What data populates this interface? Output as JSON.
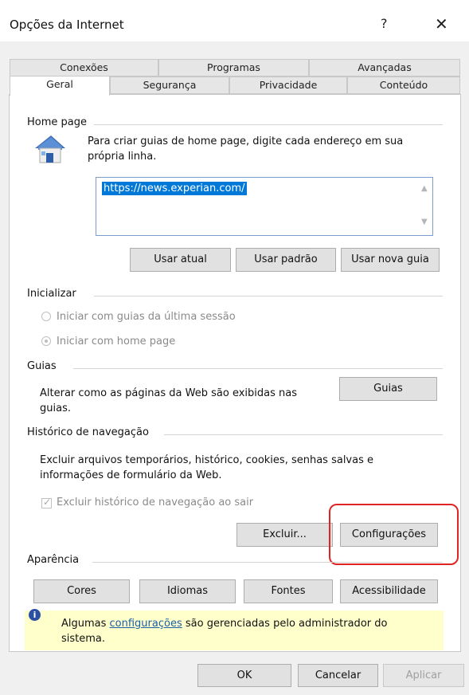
{
  "window": {
    "title": "Opções da Internet",
    "help": "?",
    "close": "✕"
  },
  "tabs": {
    "row1": [
      "Conexões",
      "Programas",
      "Avançadas"
    ],
    "row2": [
      "Geral",
      "Segurança",
      "Privacidade",
      "Conteúdo"
    ],
    "active": "Geral"
  },
  "home_page": {
    "label": "Home page",
    "description_line1": "Para criar guias de home page, digite cada endereço em sua",
    "description_line2": "própria linha.",
    "url": "https://news.experian.com/",
    "buttons": [
      "Usar atual",
      "Usar padrão",
      "Usar nova guia"
    ]
  },
  "startup": {
    "label": "Inicializar",
    "options": [
      "Iniciar com guias da última sessão",
      "Iniciar com home page"
    ],
    "selected": "Iniciar com home page"
  },
  "tabs_section": {
    "label": "Guias",
    "description_line1": "Alterar como as páginas da Web são exibidas nas",
    "description_line2": "guias.",
    "button": "Guias"
  },
  "history": {
    "label": "Histórico de navegação",
    "description_line1": "Excluir arquivos temporários, histórico, cookies, senhas salvas e",
    "description_line2": "informações de formulário da Web.",
    "checkbox_label": "Excluir histórico de navegação ao sair",
    "checkbox_checked": true,
    "delete_button": "Excluir...",
    "settings_button": "Configurações"
  },
  "appearance": {
    "label": "Aparência",
    "buttons": [
      "Cores",
      "Idiomas",
      "Fontes",
      "Acessibilidade"
    ]
  },
  "notice": {
    "text_before": "Algumas ",
    "link": "configurações",
    "text_after": " são gerenciadas pelo administrador do",
    "line2": "sistema."
  },
  "footer": {
    "ok": "OK",
    "cancel": "Cancelar",
    "apply": "Aplicar"
  },
  "colors": {
    "highlight": "#e02424",
    "notice_bg": "#ffffcc",
    "selection": "#0078d7"
  }
}
